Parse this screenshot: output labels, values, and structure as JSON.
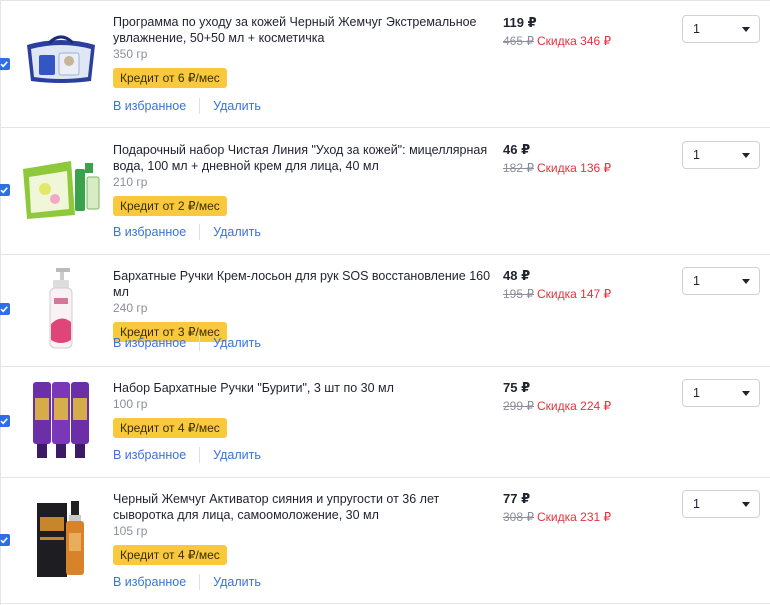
{
  "cart": {
    "items": [
      {
        "title": "Программа по уходу за кожей Черный Жемчуг Экстремальное увлажнение, 50+50 мл + косметичка",
        "weight": "350 гр",
        "credit": "Кредит от 6 ₽/мес",
        "favorite_label": "В избранное",
        "delete_label": "Удалить",
        "price": "119 ₽",
        "old_price": "465 ₽",
        "discount": "Скидка 346 ₽",
        "quantity": "1",
        "checked": true,
        "image_icon": "cosmetic-bag-product-image"
      },
      {
        "title": "Подарочный набор Чистая Линия \"Уход за кожей\": мицеллярная вода, 100 мл + дневной крем для лица, 40 мл",
        "weight": "210 гр",
        "credit": "Кредит от 2 ₽/мес",
        "favorite_label": "В избранное",
        "delete_label": "Удалить",
        "price": "46 ₽",
        "old_price": "182 ₽",
        "discount": "Скидка 136 ₽",
        "quantity": "1",
        "checked": true,
        "image_icon": "gift-box-product-image"
      },
      {
        "title": "Бархатные Ручки Крем-лосьон для рук SOS восстановление 160 мл",
        "weight": "240 гр",
        "credit": "Кредит от 3 ₽/мес",
        "favorite_label": "В избранное",
        "delete_label": "Удалить",
        "price": "48 ₽",
        "old_price": "195 ₽",
        "discount": "Скидка 147 ₽",
        "quantity": "1",
        "checked": true,
        "image_icon": "pump-bottle-product-image"
      },
      {
        "title": "Набор Бархатные Ручки \"Бурити\", 3 шт по 30 мл",
        "weight": "100 гр",
        "credit": "Кредит от 4 ₽/мес",
        "favorite_label": "В избранное",
        "delete_label": "Удалить",
        "price": "75 ₽",
        "old_price": "299 ₽",
        "discount": "Скидка 224 ₽",
        "quantity": "1",
        "checked": true,
        "image_icon": "three-tubes-product-image"
      },
      {
        "title": "Черный Жемчуг Активатор сияния и упругости от 36 лет сыворотка для лица, самоомоложение, 30 мл",
        "weight": "105 гр",
        "credit": "Кредит от 4 ₽/мес",
        "favorite_label": "В избранное",
        "delete_label": "Удалить",
        "price": "77 ₽",
        "old_price": "308 ₽",
        "discount": "Скидка 231 ₽",
        "quantity": "1",
        "checked": true,
        "image_icon": "serum-bottle-product-image"
      }
    ]
  },
  "colors": {
    "accent_link": "#3b73d9",
    "credit_badge": "#f8c93c",
    "discount_red": "#e5323c",
    "checkbox_blue": "#2f6fe5"
  }
}
